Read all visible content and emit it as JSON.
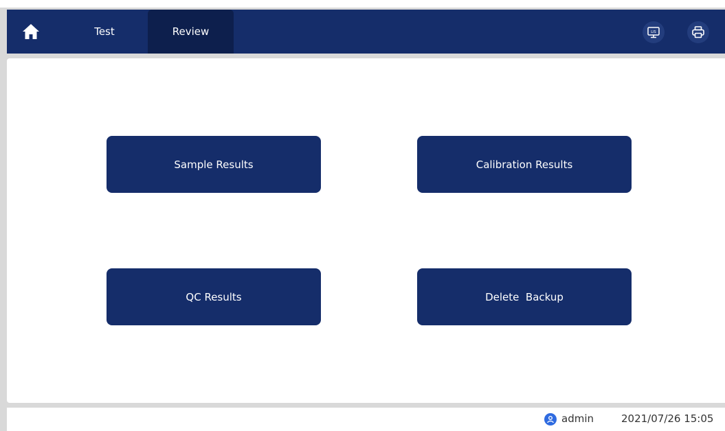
{
  "nav": {
    "home_icon": "home-icon",
    "tabs": [
      {
        "label": "Test",
        "active": false
      },
      {
        "label": "Review",
        "active": true
      }
    ],
    "right_icons": [
      "lis-monitor-icon",
      "printer-icon"
    ]
  },
  "review_menu": {
    "sample_results": "Sample Results",
    "calibration_results": "Calibration Results",
    "qc_results": "QC Results",
    "delete_backup": "Delete  Backup"
  },
  "status": {
    "user_icon": "user-icon",
    "user": "admin",
    "datetime": "2021/07/26 15:05"
  },
  "colors": {
    "nav_background": "#152d6a",
    "active_tab": "#0d1f4d",
    "button_background": "#152d6a",
    "frame_gray": "#d9d9d9",
    "user_icon_blue": "#2f6be0"
  }
}
